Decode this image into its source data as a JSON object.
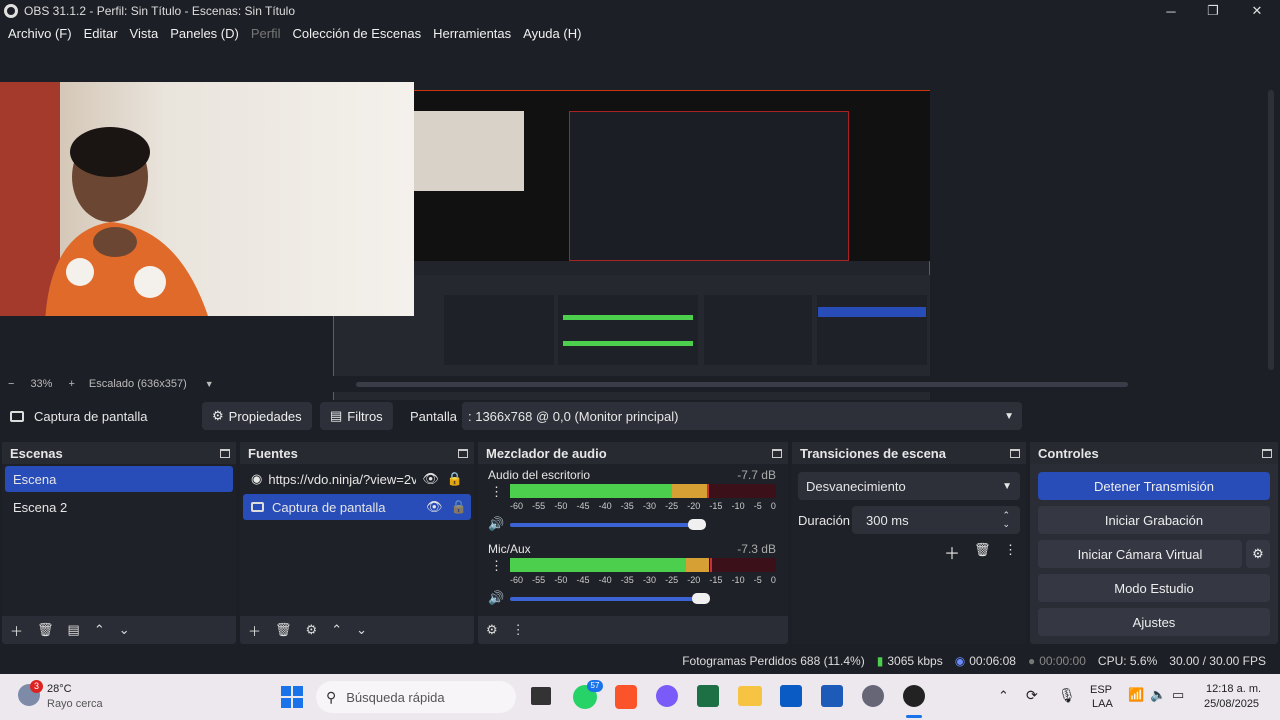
{
  "window": {
    "title": "OBS 31.1.2 - Perfil: Sin Título - Escenas: Sin Título"
  },
  "menu": [
    {
      "label": "Archivo (F)",
      "enabled": true
    },
    {
      "label": "Editar",
      "enabled": true
    },
    {
      "label": "Vista",
      "enabled": true
    },
    {
      "label": "Paneles (D)",
      "enabled": true
    },
    {
      "label": "Perfil",
      "enabled": false
    },
    {
      "label": "Colección de Escenas",
      "enabled": true
    },
    {
      "label": "Herramientas",
      "enabled": true
    },
    {
      "label": "Ayuda (H)",
      "enabled": true
    }
  ],
  "zoom": {
    "level": "33%",
    "scaling": "Escalado (636x357)"
  },
  "source_toolbar": {
    "source_name": "Captura de pantalla",
    "properties_label": "Propiedades",
    "filters_label": "Filtros",
    "display_label": "Pantalla",
    "display_value": ": 1366x768 @ 0,0 (Monitor principal)"
  },
  "scenes": {
    "title": "Escenas",
    "items": [
      "Escena",
      "Escena 2"
    ],
    "selected": 0
  },
  "sources": {
    "title": "Fuentes",
    "items": [
      "https://vdo.ninja/?view=2v",
      "Captura de pantalla"
    ],
    "selected": 1
  },
  "mixer": {
    "title": "Mezclador de audio",
    "channels": [
      {
        "name": "Audio del escritorio",
        "db": "-7.7 dB",
        "level": 0.75,
        "volume": 0.8
      },
      {
        "name": "Mic/Aux",
        "db": "-7.3 dB",
        "level": 0.73,
        "volume": 0.82
      }
    ],
    "ticks": [
      "-60",
      "-55",
      "-50",
      "-45",
      "-40",
      "-35",
      "-30",
      "-25",
      "-20",
      "-15",
      "-10",
      "-5",
      "0"
    ]
  },
  "transitions": {
    "title": "Transiciones de escena",
    "type": "Desvanecimiento",
    "duration_label": "Duración",
    "duration_value": "300 ms"
  },
  "controls": {
    "title": "Controles",
    "stop_stream": "Detener Transmisión",
    "start_record": "Iniciar Grabación",
    "virtual_cam": "Iniciar Cámara Virtual",
    "studio_mode": "Modo Estudio",
    "settings": "Ajustes"
  },
  "status": {
    "dropped": "Fotogramas Perdidos 688 (11.4%)",
    "bitrate": "3065 kbps",
    "stream_time": "00:06:08",
    "rec_time": "00:00:00",
    "cpu": "CPU: 5.6%",
    "fps": "30.00 / 30.00 FPS"
  },
  "taskbar": {
    "weather_temp": "28°C",
    "weather_desc": "Rayo cerca",
    "weather_badge": "3",
    "search_placeholder": "Búsqueda rápida",
    "whatsapp_badge": "57",
    "lang1": "ESP",
    "lang2": "LAA",
    "time": "12:18 a. m.",
    "date": "25/08/2025"
  },
  "colors": {
    "accent": "#284cb8",
    "bg": "#1d1f26",
    "panel": "#2a2d35"
  }
}
